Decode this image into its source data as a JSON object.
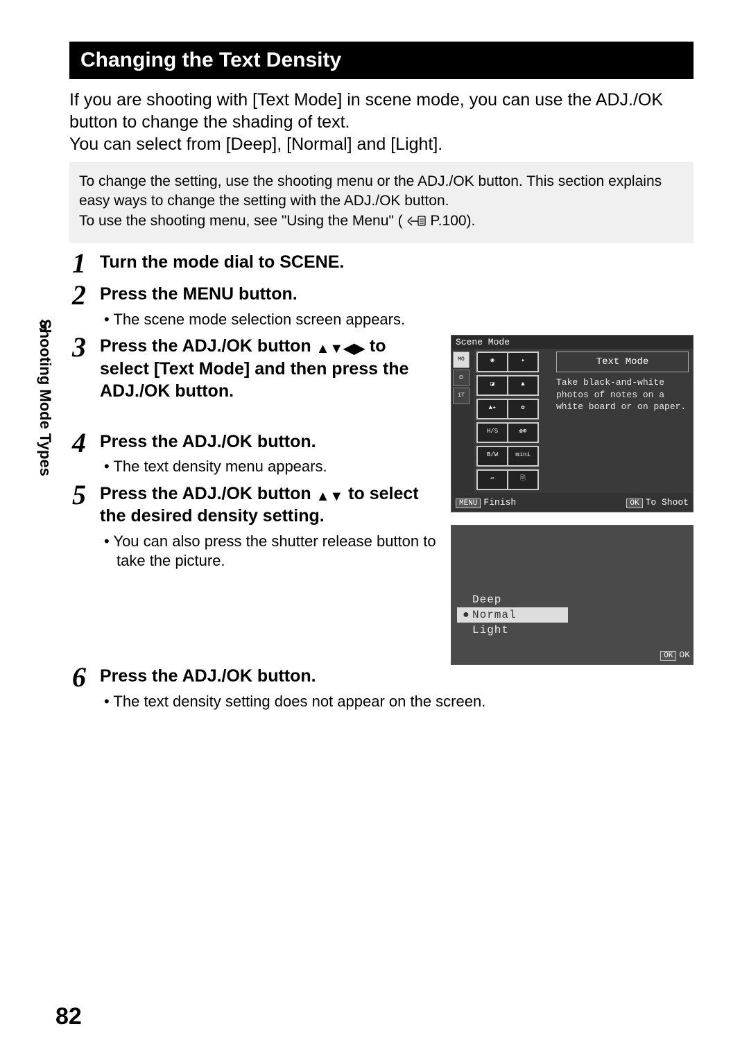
{
  "sidebar": {
    "chapter_num": "3",
    "chapter_title": "Shooting Mode Types"
  },
  "page_number": "82",
  "header": "Changing the Text Density",
  "intro_line1": "If you are shooting with [Text Mode] in scene mode, you can use the ADJ./OK button to change the shading of text.",
  "intro_line2": "You can select from [Deep], [Normal] and [Light].",
  "note_line1": "To change the setting, use the shooting menu or the ADJ./OK button. This section explains easy ways to change the setting with the ADJ./OK button.",
  "note_line2a": "To use the shooting menu, see \"Using the Menu\" (",
  "note_line2b": "P.100).",
  "steps": {
    "1": {
      "h": "Turn the mode dial to SCENE."
    },
    "2": {
      "h": "Press the MENU button.",
      "sub": "The scene mode selection screen appears."
    },
    "3": {
      "h_a": "Press the ADJ./OK button ",
      "h_b": " to select [Text Mode] and then press the ADJ./OK button."
    },
    "4": {
      "h": "Press the ADJ./OK button.",
      "sub": "The text density menu appears."
    },
    "5": {
      "h_a": "Press the ADJ./OK button ",
      "h_b": " to select the desired density setting.",
      "sub": "You can also press the shutter release button to take the picture."
    },
    "6": {
      "h": "Press the ADJ./OK button.",
      "sub": "The text density setting does not appear on the screen."
    }
  },
  "screen1": {
    "title": "Scene Mode",
    "info_title": "Text Mode",
    "info_desc": "Take black-and-white photos of\nnotes on a white board or on\npaper.",
    "menu_btn": "MENU",
    "menu_label": "Finish",
    "ok_btn": "OK",
    "ok_label": "To Shoot"
  },
  "screen2": {
    "items": [
      "Deep",
      "Normal",
      "Light"
    ],
    "selected_index": 1,
    "ok_btn": "OK",
    "ok_label": "OK"
  }
}
